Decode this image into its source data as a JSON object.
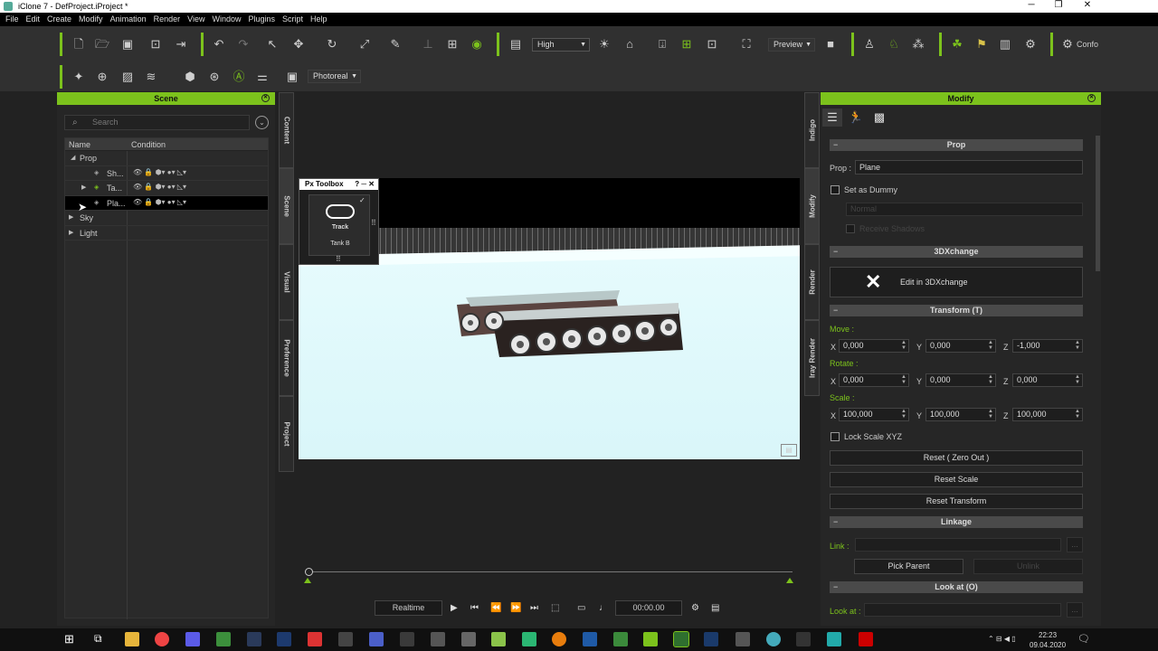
{
  "window": {
    "title": "iClone 7 - DefProject.iProject *",
    "minimize": "─",
    "maximize": "❐",
    "close": "✕"
  },
  "menu": [
    "File",
    "Edit",
    "Create",
    "Modify",
    "Animation",
    "Render",
    "View",
    "Window",
    "Plugins",
    "Script",
    "Help"
  ],
  "toolbar": {
    "quality": "High",
    "preview_mode": "Preview",
    "render_mode": "Photoreal",
    "config_label": "Confo"
  },
  "scene_panel": {
    "title": "Scene",
    "search_placeholder": "Search",
    "columns": [
      "Name",
      "Condition"
    ],
    "rows": [
      {
        "label": "Prop",
        "tri": "◢",
        "level": 0
      },
      {
        "label": "Sh...",
        "tri": "",
        "level": 2
      },
      {
        "label": "Ta...",
        "tri": "▶",
        "level": 2
      },
      {
        "label": "Pla...",
        "tri": "",
        "level": 2,
        "selected": true
      },
      {
        "label": "Sky",
        "tri": "▶",
        "level": 0
      },
      {
        "label": "Light",
        "tri": "▶",
        "level": 0
      }
    ],
    "condition_icons": "👁  🔒  ⬢▾  ●▾  ◺▾"
  },
  "left_tabs": [
    "Content",
    "Scene",
    "Visual",
    "Preference",
    "Project"
  ],
  "right_tabs": [
    "Indigo",
    "Modify",
    "Render",
    "Iray Render"
  ],
  "px_toolbox": {
    "title": "Px Toolbox",
    "controls": "? ─ ✕",
    "item_label": "Track",
    "item_name": "Tank B"
  },
  "playback": {
    "mode": "Realtime",
    "time": "00:00.00"
  },
  "modify_panel": {
    "title": "Modify",
    "prop_section": "Prop",
    "prop_label": "Prop :",
    "prop_value": "Plane",
    "set_as_dummy": "Set as Dummy",
    "dummy_mode": "Normal",
    "receive_shadows": "Receive Shadows",
    "xchange_section": "3DXchange",
    "xchange_button": "Edit in 3DXchange",
    "transform_section": "Transform  (T)",
    "move_label": "Move :",
    "rotate_label": "Rotate :",
    "scale_label": "Scale :",
    "move": {
      "x": "0,000",
      "y": "0,000",
      "z": "-1,000"
    },
    "rotate": {
      "x": "0,000",
      "y": "0,000",
      "z": "0,000"
    },
    "scale": {
      "x": "100,000",
      "y": "100,000",
      "z": "100,000"
    },
    "axis": {
      "x": "X",
      "y": "Y",
      "z": "Z"
    },
    "lock_scale": "Lock Scale XYZ",
    "reset_zero": "Reset ( Zero Out )",
    "reset_scale": "Reset Scale",
    "reset_transform": "Reset Transform",
    "linkage_section": "Linkage",
    "link_label": "Link :",
    "pick_parent": "Pick Parent",
    "unlink": "Unlink",
    "lookat_section": "Look at  (O)",
    "lookat_label": "Look at :",
    "ellipsis": "..."
  },
  "clock": {
    "time": "22:23",
    "date": "09.04.2020"
  },
  "colors": {
    "accent": "#7cc21c"
  }
}
